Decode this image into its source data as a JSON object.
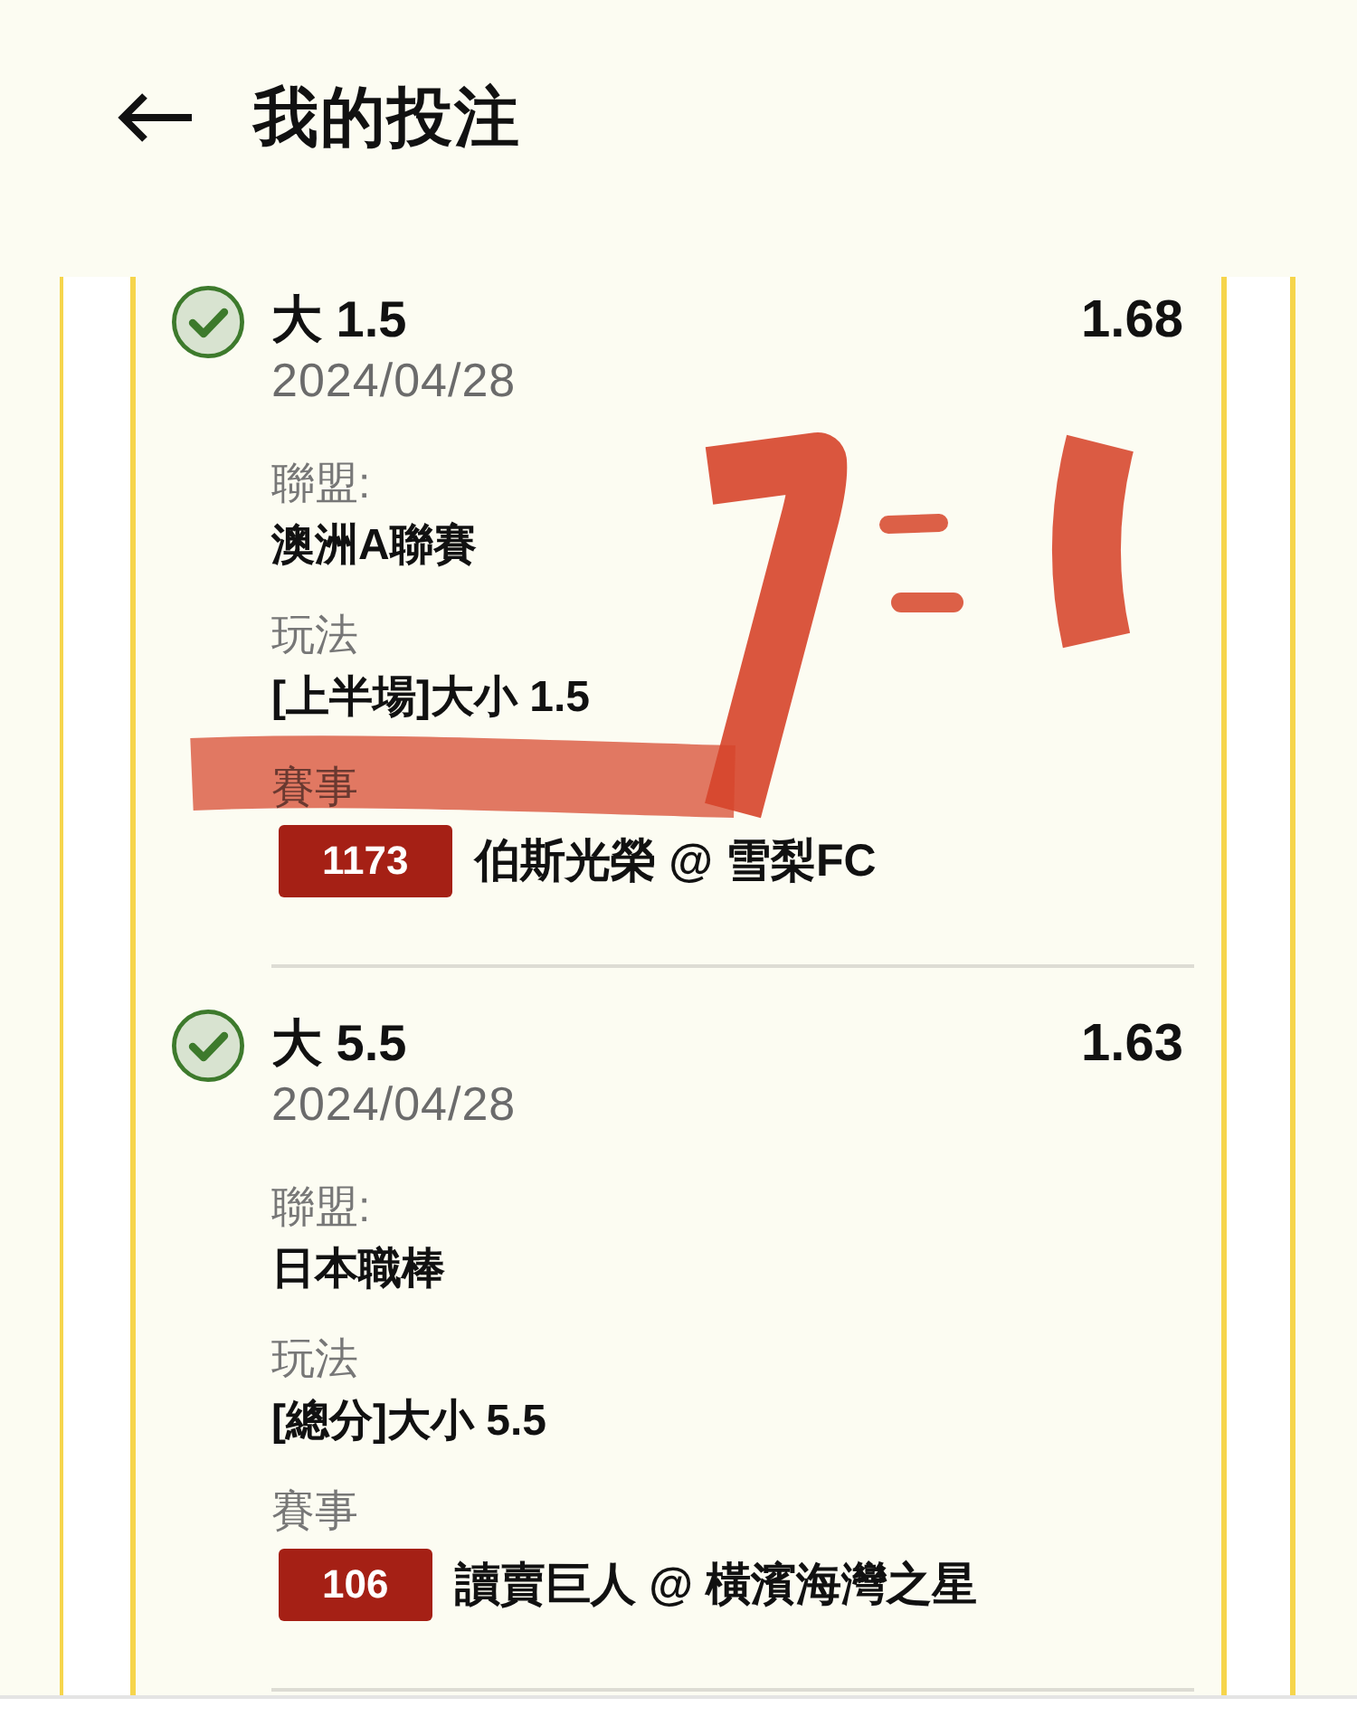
{
  "header": {
    "title": "我的投注"
  },
  "bets": [
    {
      "checked": true,
      "selection": "大 1.5",
      "odds": "1.68",
      "date": "2024/04/28",
      "details": [
        {
          "label": "聯盟:",
          "value": "澳洲A聯賽"
        },
        {
          "label": "玩法",
          "value": "[上半場]大小 1.5"
        }
      ],
      "event": {
        "label": "賽事",
        "number": "1173",
        "teams": "伯斯光榮 @ 雪梨FC"
      }
    },
    {
      "checked": true,
      "selection": "大 5.5",
      "odds": "1.63",
      "date": "2024/04/28",
      "details": [
        {
          "label": "聯盟:",
          "value": "日本職棒"
        },
        {
          "label": "玩法",
          "value": "[總分]大小 5.5"
        }
      ],
      "event": {
        "label": "賽事",
        "number": "106",
        "teams": "讀賣巨人 @ 橫濱海灣之星"
      }
    }
  ],
  "annotation": {
    "kind": "scribble"
  }
}
